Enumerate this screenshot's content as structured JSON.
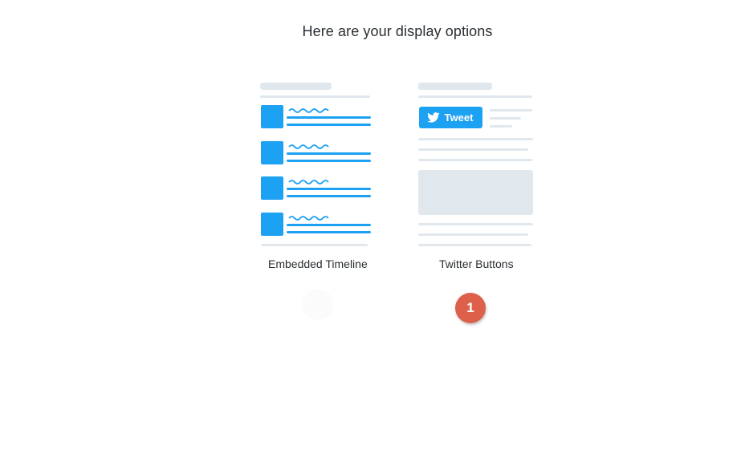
{
  "page": {
    "heading": "Here are your display options"
  },
  "options": [
    {
      "id": "embedded-timeline",
      "label": "Embedded Timeline"
    },
    {
      "id": "twitter-buttons",
      "label": "Twitter Buttons"
    }
  ],
  "tweet_button": {
    "label": "Tweet",
    "icon": "twitter-bird-icon"
  },
  "badge": {
    "text": "1"
  },
  "colors": {
    "accent": "#1da1f2",
    "placeholder": "#e1e8ed",
    "badge": "#dd614a",
    "text": "#292f33"
  }
}
